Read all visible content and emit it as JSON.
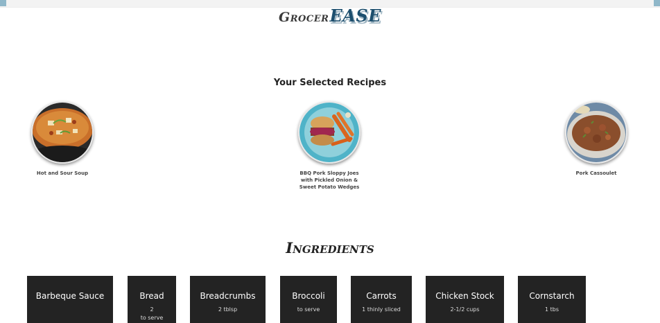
{
  "brand": {
    "part1": "Grocer",
    "part2": "EASE"
  },
  "recipes_section": {
    "title": "Your Selected Recipes"
  },
  "recipes": [
    {
      "name": "Hot and Sour Soup"
    },
    {
      "name": "BBQ Pork Sloppy Joes with Pickled Onion & Sweet Potato Wedges"
    },
    {
      "name": "Pork Cassoulet"
    }
  ],
  "ingredients_section": {
    "title": "Ingredients"
  },
  "ingredients": [
    {
      "name": "Barbeque Sauce",
      "qty": ""
    },
    {
      "name": "Bread",
      "qty": "2",
      "qty_extra": "to serve"
    },
    {
      "name": "Breadcrumbs",
      "qty": "2 tblsp"
    },
    {
      "name": "Broccoli",
      "qty": "to serve"
    },
    {
      "name": "Carrots",
      "qty": "1 thinly sliced"
    },
    {
      "name": "Chicken Stock",
      "qty": "2-1/2 cups"
    },
    {
      "name": "Cornstarch",
      "qty": "1 tbs"
    }
  ],
  "colors": {
    "card_bg": "#232323",
    "logo_accent": "#1d4f6e",
    "topbar": "#f3f3f3"
  }
}
